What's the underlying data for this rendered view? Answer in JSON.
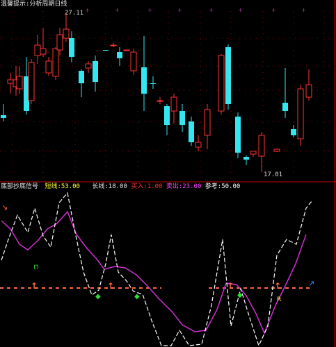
{
  "window": {
    "top_title": "温馨提示:分析周期日线",
    "price_high_label": "27.11",
    "price_low_label": "17.01"
  },
  "indicator": {
    "title": "底部抄底信号",
    "params": [
      {
        "label": "短线:",
        "value": "53.00",
        "color": "#ffff33"
      },
      {
        "label": "长线:",
        "value": "18.00",
        "color": "#e8e8e8"
      },
      {
        "label": "买入:",
        "value": "1.00",
        "color": "#ff3333"
      },
      {
        "label": "卖出:",
        "value": "23.00",
        "color": "#ff44ff"
      },
      {
        "label": "参考:",
        "value": "50.00",
        "color": "#ffffff"
      }
    ]
  },
  "colors": {
    "up": "#ff3333",
    "down": "#33e6f0",
    "grid": "#a00000",
    "short_line": "#ffffff",
    "long_line": "#d030d0",
    "reference_line": "#ff6a3a",
    "axis": "#c00000"
  },
  "icons": {
    "buy_arrow": "arrow-up-icon",
    "sell_arrow": "arrow-down-icon",
    "diamond": "diamond-icon"
  }
}
